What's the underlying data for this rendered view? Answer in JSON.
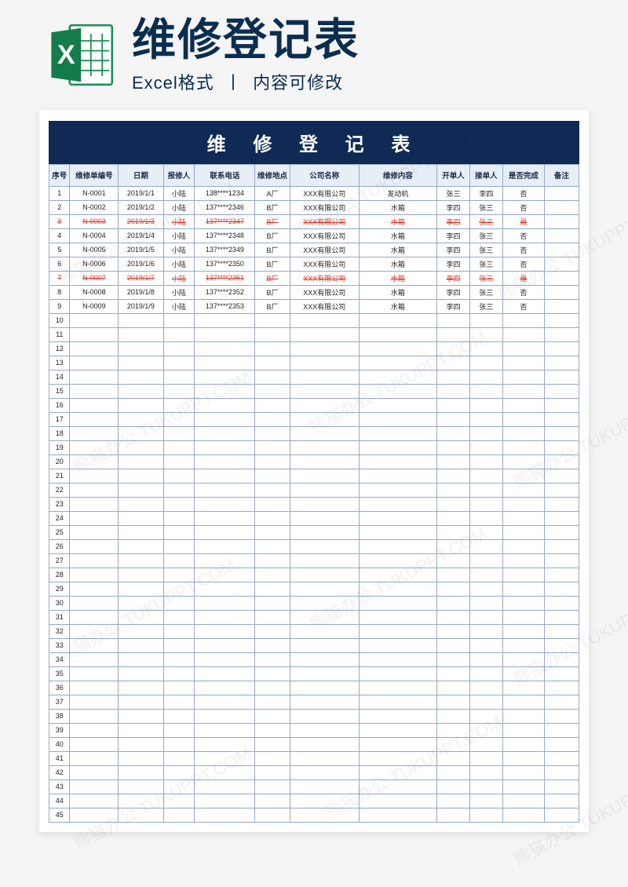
{
  "header": {
    "title": "维修登记表",
    "sub_format": "Excel格式",
    "sub_sep": "丨",
    "sub_editable": "内容可修改",
    "icon_letter": "X"
  },
  "sheet": {
    "title": "维 修 登 记 表",
    "columns": [
      "序号",
      "维修单编号",
      "日期",
      "报修人",
      "联系电话",
      "维修地点",
      "公司名称",
      "维修内容",
      "开单人",
      "接单人",
      "是否完成",
      "备注"
    ],
    "rows": [
      {
        "seq": "1",
        "id": "N-0001",
        "date": "2019/1/1",
        "reporter": "小陆",
        "tel": "138****1234",
        "loc": "A厂",
        "company": "XXX有限公司",
        "content": "发动机",
        "opener": "张三",
        "receiver": "李四",
        "done": "否",
        "note": "",
        "strike": false
      },
      {
        "seq": "2",
        "id": "N-0002",
        "date": "2019/1/2",
        "reporter": "小陆",
        "tel": "137****2346",
        "loc": "B厂",
        "company": "XXX有限公司",
        "content": "水箱",
        "opener": "李四",
        "receiver": "张三",
        "done": "否",
        "note": "",
        "strike": false
      },
      {
        "seq": "3",
        "id": "N-0003",
        "date": "2019/1/3",
        "reporter": "小陆",
        "tel": "137****2347",
        "loc": "B厂",
        "company": "XXX有限公司",
        "content": "水箱",
        "opener": "李四",
        "receiver": "张三",
        "done": "是",
        "note": "",
        "strike": true
      },
      {
        "seq": "4",
        "id": "N-0004",
        "date": "2019/1/4",
        "reporter": "小陆",
        "tel": "137****2348",
        "loc": "B厂",
        "company": "XXX有限公司",
        "content": "水箱",
        "opener": "李四",
        "receiver": "张三",
        "done": "否",
        "note": "",
        "strike": false
      },
      {
        "seq": "5",
        "id": "N-0005",
        "date": "2019/1/5",
        "reporter": "小陆",
        "tel": "137****2349",
        "loc": "B厂",
        "company": "XXX有限公司",
        "content": "水箱",
        "opener": "李四",
        "receiver": "张三",
        "done": "否",
        "note": "",
        "strike": false
      },
      {
        "seq": "6",
        "id": "N-0006",
        "date": "2019/1/6",
        "reporter": "小陆",
        "tel": "137****2350",
        "loc": "B厂",
        "company": "XXX有限公司",
        "content": "水箱",
        "opener": "李四",
        "receiver": "张三",
        "done": "否",
        "note": "",
        "strike": false
      },
      {
        "seq": "7",
        "id": "N-0007",
        "date": "2019/1/7",
        "reporter": "小陆",
        "tel": "137****2351",
        "loc": "B厂",
        "company": "XXX有限公司",
        "content": "水箱",
        "opener": "李四",
        "receiver": "张三",
        "done": "是",
        "note": "",
        "strike": true
      },
      {
        "seq": "8",
        "id": "N-0008",
        "date": "2019/1/8",
        "reporter": "小陆",
        "tel": "137****2352",
        "loc": "B厂",
        "company": "XXX有限公司",
        "content": "水箱",
        "opener": "李四",
        "receiver": "张三",
        "done": "否",
        "note": "",
        "strike": false
      },
      {
        "seq": "9",
        "id": "N-0009",
        "date": "2019/1/9",
        "reporter": "小陆",
        "tel": "137****2353",
        "loc": "B厂",
        "company": "XXX有限公司",
        "content": "水箱",
        "opener": "李四",
        "receiver": "张三",
        "done": "否",
        "note": "",
        "strike": false
      }
    ],
    "empty_row_start": 10,
    "empty_row_end": 45
  },
  "watermark": "熊猫办公 TUKUPPT.COM"
}
